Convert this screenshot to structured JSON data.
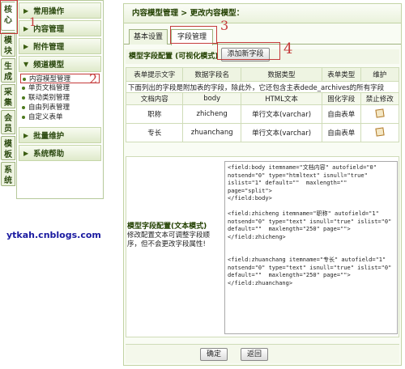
{
  "vertical_tabs": [
    "核心",
    "模块",
    "生成",
    "采集",
    "会员",
    "模板",
    "系统"
  ],
  "sidebar": {
    "categories": [
      {
        "label": "常用操作"
      },
      {
        "label": "内容管理"
      },
      {
        "label": "附件管理"
      },
      {
        "label": "频道模型",
        "items": [
          "内容模型管理",
          "单页文档管理",
          "联动类别管理",
          "自由列表管理",
          "自定义表单"
        ]
      },
      {
        "label": "批量维护"
      },
      {
        "label": "系统帮助"
      }
    ]
  },
  "watermark": "ytkah.cnblogs.com",
  "main": {
    "breadcrumb": "内容模型管理 > 更改内容模型：",
    "tabs": [
      "基本设置",
      "字段管理"
    ],
    "section_title": "模型字段配置 (可视化模式)",
    "add_button": "添加新字段",
    "table": {
      "headers": [
        "表单提示文字",
        "数据字段名",
        "数据类型",
        "表单类型",
        "维护"
      ],
      "note": "下面列出的字段是附加表的字段，除此外，它还包含主表dede_archives的所有字段",
      "sub_headers": [
        "文档内容",
        "body",
        "HTML文本",
        "固化字段",
        "禁止修改"
      ],
      "rows": [
        [
          "职称",
          "zhicheng",
          "单行文本(varchar)",
          "自由表单"
        ],
        [
          "专长",
          "zhuanchang",
          "单行文本(varchar)",
          "自由表单"
        ]
      ]
    },
    "text_mode_title": "模型字段配置(文本模式)",
    "text_mode_desc": "修改配置文本可调整字段顺序，但不会更改字段属性!",
    "code": "<field:body itemname=\"文档内容\" autofield=\"0\"\nnotsend=\"0\" type=\"htmltext\" isnull=\"true\"\nislist=\"1\" default=\"\"  maxlength=\"\"\npage=\"split\">\n</field:body>\n\n<field:zhicheng itemname=\"职称\" autofield=\"1\"\nnotsend=\"0\" type=\"text\" isnull=\"true\" islist=\"0\"\ndefault=\"\"  maxlength=\"250\" page=\"\">\n</field:zhicheng>\n\n\n<field:zhuanchang itemname=\"专长\" autofield=\"1\"\nnotsend=\"0\" type=\"text\" isnull=\"true\" islist=\"0\"\ndefault=\"\"  maxlength=\"250\" page=\"\">\n</field:zhuanchang>",
    "ok_button": "确定",
    "back_button": "返回"
  },
  "annotations": [
    "1",
    "2",
    "3",
    "4"
  ]
}
